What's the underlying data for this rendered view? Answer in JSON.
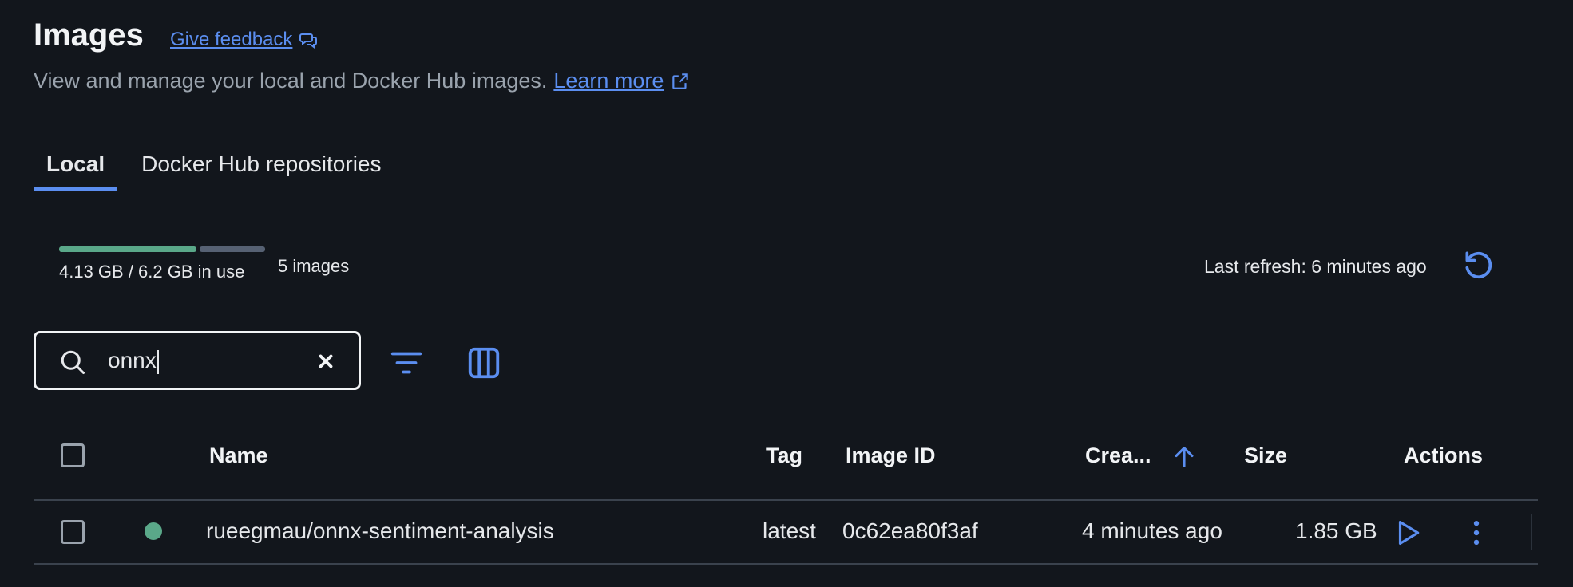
{
  "header": {
    "title": "Images",
    "feedback_label": "Give feedback",
    "subtitle": "View and manage your local and Docker Hub images.",
    "learn_more": "Learn more"
  },
  "tabs": [
    {
      "label": "Local",
      "active": true
    },
    {
      "label": "Docker Hub repositories",
      "active": false
    }
  ],
  "usage": {
    "text": "4.13 GB / 6.2 GB in use",
    "fraction_used": 0.666,
    "image_count": "5 images",
    "last_refresh": "Last refresh: 6 minutes ago"
  },
  "search": {
    "value": "onnx",
    "placeholder": "Search"
  },
  "table": {
    "columns": {
      "name": "Name",
      "tag": "Tag",
      "image_id": "Image ID",
      "created": "Crea...",
      "size": "Size",
      "actions": "Actions"
    },
    "sort_column": "created",
    "sort_direction": "ascending",
    "rows": [
      {
        "status": "in-use",
        "name": "rueegmau/onnx-sentiment-analysis",
        "tag": "latest",
        "image_id": "0c62ea80f3af",
        "created": "4 minutes ago",
        "size": "1.85 GB"
      }
    ]
  },
  "colors": {
    "background": "#12161c",
    "accent": "#5b8ef0",
    "usage_used": "#5aa889",
    "usage_free": "#566173",
    "status_in_use": "#5aa889"
  },
  "icons": [
    "external-link-icon",
    "feedback-icon",
    "refresh-icon",
    "search-icon",
    "clear-icon",
    "filter-icon",
    "columns-icon",
    "sort-arrow-up-icon",
    "play-icon",
    "kebab-menu-icon"
  ]
}
